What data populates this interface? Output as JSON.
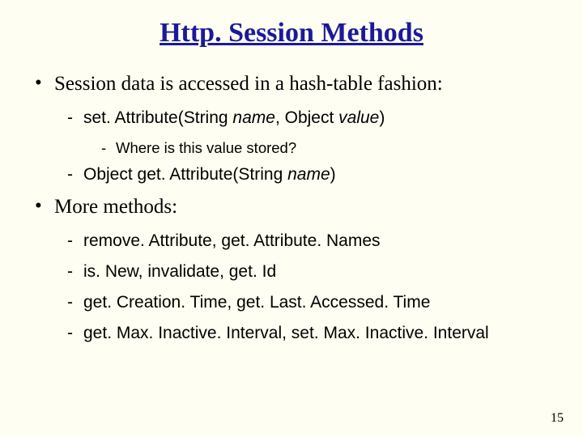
{
  "title": "Http. Session Methods",
  "bullets": {
    "b1": "Session data is accessed in a hash-table fashion:",
    "b1_1": "set. Attribute(String ",
    "b1_1_name": "name",
    "b1_1_mid": ", Object ",
    "b1_1_value": "value",
    "b1_1_end": ")",
    "b1_1_1": "Where is this value stored?",
    "b1_2": "Object get. Attribute(String ",
    "b1_2_name": "name",
    "b1_2_end": ")",
    "b2": "More methods:",
    "b2_1": "remove. Attribute, get. Attribute. Names",
    "b2_2": "is. New, invalidate, get. Id",
    "b2_3": "get. Creation. Time, get. Last. Accessed. Time",
    "b2_4": "get. Max. Inactive. Interval, set. Max. Inactive. Interval"
  },
  "pageNumber": "15"
}
